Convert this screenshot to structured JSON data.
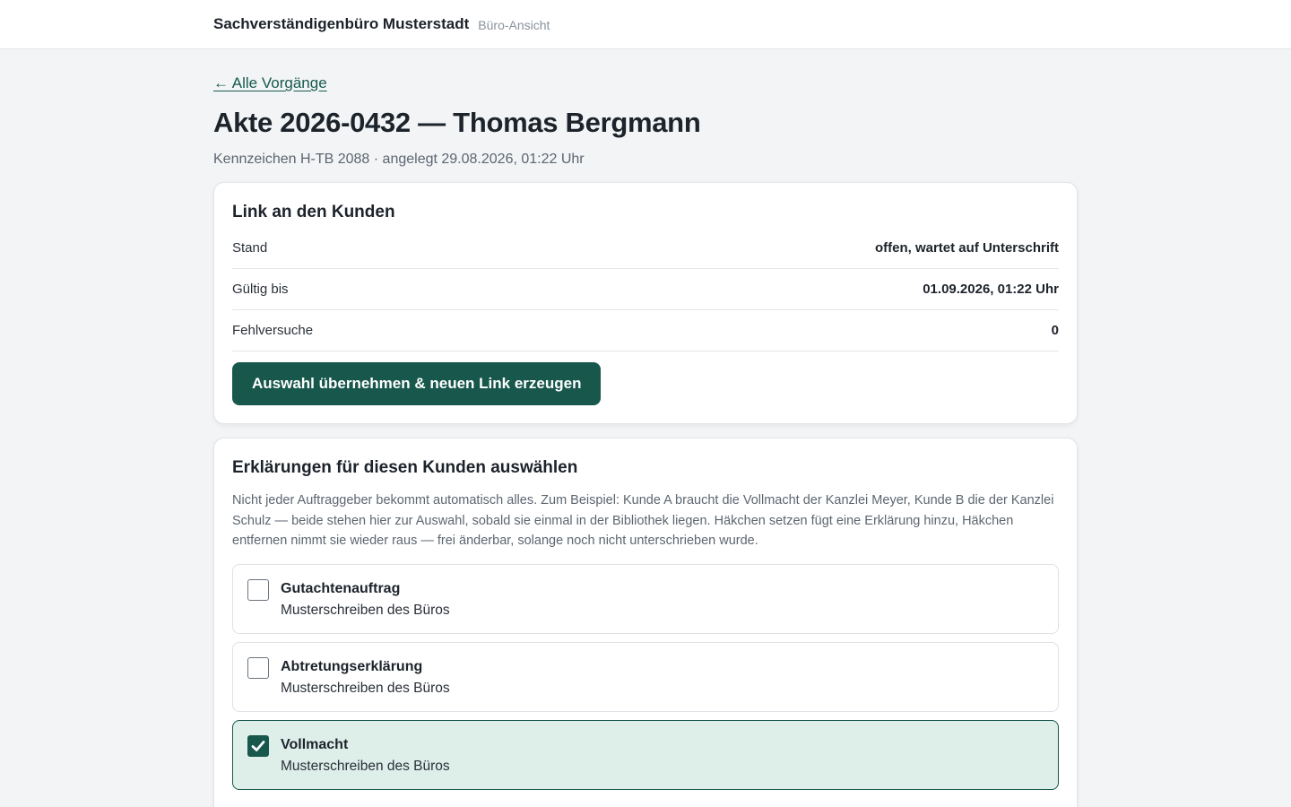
{
  "header": {
    "brand": "Sachverständigenbüro Musterstadt",
    "view_label": "Büro-Ansicht"
  },
  "nav": {
    "back_link": "← Alle Vorgänge"
  },
  "case": {
    "title": "Akte 2026-0432 — Thomas Bergmann",
    "meta": "Kennzeichen H-TB 2088 · angelegt 29.08.2026, 01:22 Uhr"
  },
  "link_card": {
    "title": "Link an den Kunden",
    "rows": [
      {
        "label": "Stand",
        "value": "offen, wartet auf Unterschrift"
      },
      {
        "label": "Gültig bis",
        "value": "01.09.2026, 01:22 Uhr"
      },
      {
        "label": "Fehlversuche",
        "value": "0"
      }
    ],
    "button_label": "Auswahl übernehmen & neuen Link erzeugen"
  },
  "declarations_card": {
    "title": "Erklärungen für diesen Kunden auswählen",
    "description": "Nicht jeder Auftraggeber bekommt automatisch alles. Zum Beispiel: Kunde A braucht die Vollmacht der Kanzlei Meyer, Kunde B die der Kanzlei Schulz — beide stehen hier zur Auswahl, sobald sie einmal in der Bibliothek liegen. Häkchen setzen fügt eine Erklärung hinzu, Häkchen entfernen nimmt sie wieder raus — frei änderbar, solange noch nicht unterschrieben wurde.",
    "options": [
      {
        "name": "Gutachtenauftrag",
        "source": "Musterschreiben des Büros",
        "checked": false
      },
      {
        "name": "Abtretungserklärung",
        "source": "Musterschreiben des Büros",
        "checked": false
      },
      {
        "name": "Vollmacht",
        "source": "Musterschreiben des Büros",
        "checked": true
      }
    ]
  },
  "colors": {
    "accent": "#17574c",
    "selected_bg": "#deefea"
  }
}
